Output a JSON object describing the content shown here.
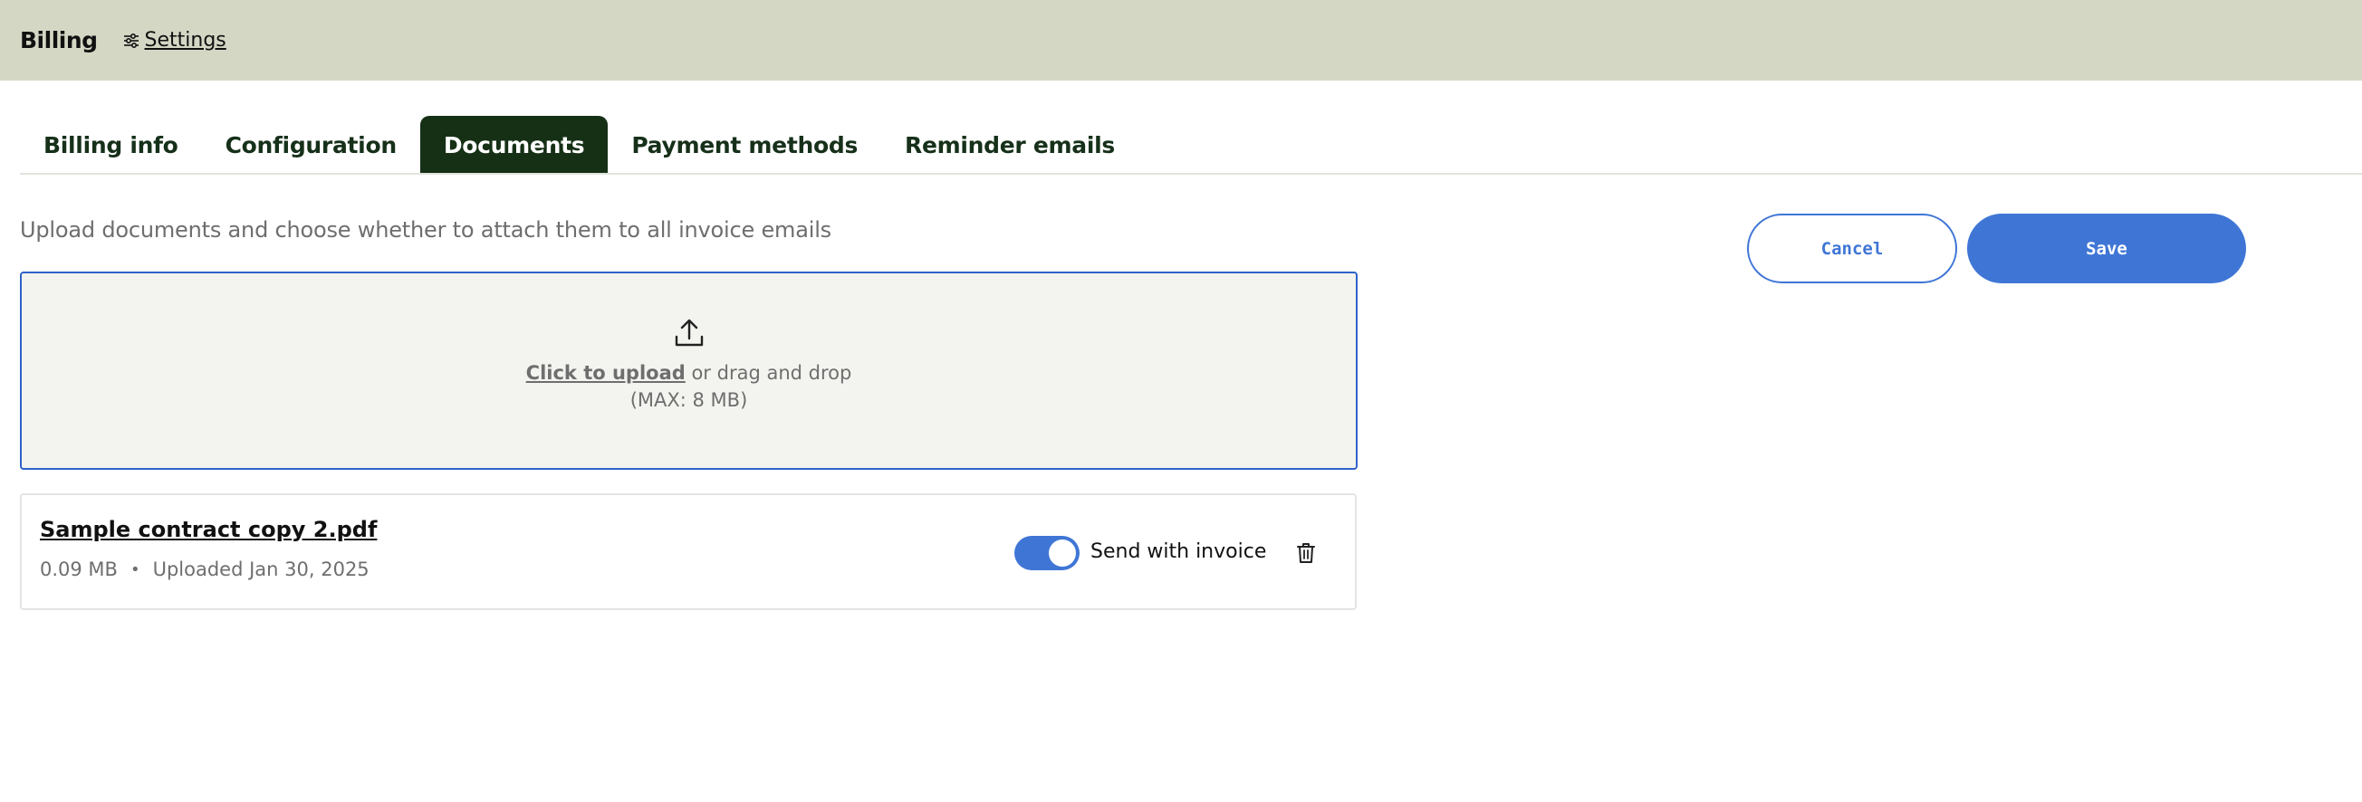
{
  "header": {
    "title": "Billing",
    "settings_label": "Settings",
    "settings_icon": "sliders-icon"
  },
  "tabs": [
    {
      "label": "Billing info",
      "active": false
    },
    {
      "label": "Configuration",
      "active": false
    },
    {
      "label": "Documents",
      "active": true
    },
    {
      "label": "Payment methods",
      "active": false
    },
    {
      "label": "Reminder emails",
      "active": false
    }
  ],
  "documents": {
    "description": "Upload documents and choose whether to attach them to all invoice emails",
    "dropzone": {
      "icon": "upload-icon",
      "upload_link": "Click to upload",
      "upload_rest": " or drag and drop",
      "max_size": "(MAX: 8 MB)"
    },
    "files": [
      {
        "name": "Sample contract copy 2.pdf",
        "size": "0.09 MB",
        "separator": "•",
        "uploaded": "Uploaded Jan 30, 2025",
        "send_with_invoice": true,
        "toggle_label": "Send with invoice",
        "delete_icon": "trash-icon"
      }
    ]
  },
  "actions": {
    "cancel_label": "Cancel",
    "save_label": "Save"
  },
  "colors": {
    "header_bg": "#d4d7c4",
    "active_tab_bg": "#163016",
    "accent": "#3f76d6",
    "dropzone_border": "#2f62c9",
    "dropzone_bg": "#f3f4ef"
  }
}
